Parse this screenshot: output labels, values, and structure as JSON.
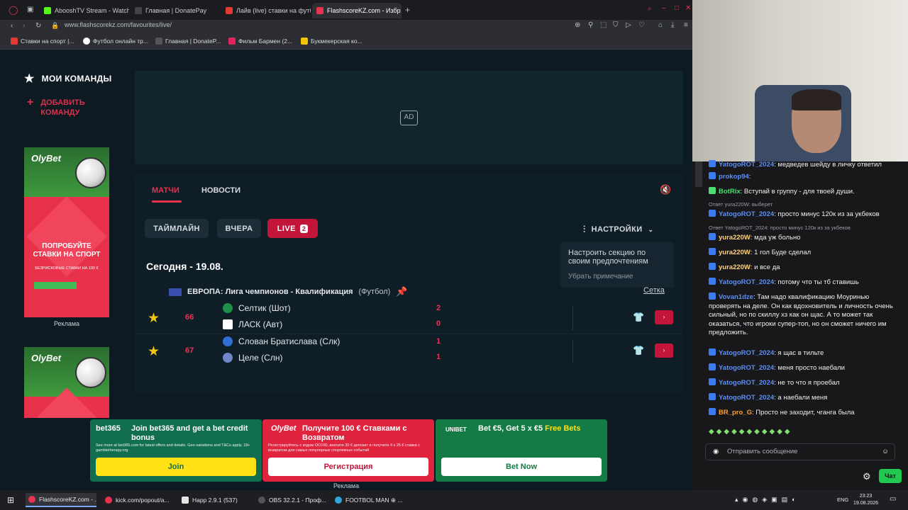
{
  "browser": {
    "tabs": [
      {
        "label": "AbooshTV Stream - Watch",
        "color": "#53fc18"
      },
      {
        "label": "Главная | DonatePay",
        "color": "#2b2b2b"
      },
      {
        "label": "Лайв (live) ставки на футб",
        "color": "#e53935"
      },
      {
        "label": "FlashscoreKZ.com - Избр",
        "color": "#e8334f"
      }
    ],
    "url": "www.flashscorekz.com/favourites/live/",
    "bookmarks": [
      {
        "label": "Ставки на спорт |...",
        "color": "#e53935"
      },
      {
        "label": "Футбол онлайн тр...",
        "color": "#ffffff"
      },
      {
        "label": "Главная | DonateP...",
        "color": "#2b2b2b"
      },
      {
        "label": "Фильм Бармен (2...",
        "color": "#e0245e"
      },
      {
        "label": "Букмекерская ко...",
        "color": "#f5c400"
      }
    ]
  },
  "sidebar": {
    "title": "МОИ КОМАНДЫ",
    "add_team": "ДОБАВИТЬ КОМАНДУ",
    "ad_label": "Реклама",
    "olybet_logo": "OlyBet",
    "olybet_promo": "ПОПРОБУЙТЕ СТАВКИ НА СПОРТ",
    "olybet_sub": "БЕЗРИСКОВЫЕ СТАВКИ НА 100 €"
  },
  "adbox": {
    "label": "AD"
  },
  "main": {
    "tabs": [
      {
        "label": "МАТЧИ"
      },
      {
        "label": "НОВОСТИ"
      }
    ],
    "filters": [
      {
        "label": "ТАЙМЛАЙН"
      },
      {
        "label": "ВЧЕРА"
      },
      {
        "label": "LIVE",
        "count": "2"
      }
    ],
    "settings_label": "НАСТРОЙКИ",
    "tooltip": {
      "text": "Настроить секцию по своим предпочтениям",
      "dismiss": "Убрать примечание"
    },
    "date_heading": "Сегодня - 19.08.",
    "league": {
      "name": "ЕВРОПА: Лига чемпионов - Квалификация",
      "category": "(Футбол)",
      "grid_link": "Сетка"
    },
    "matches": [
      {
        "minute": "66",
        "home": "Селтик (Шот)",
        "away": "ЛАСК (Авт)",
        "home_score": "2",
        "away_score": "0",
        "home_color": "#1f8f4a",
        "away_color": "#ffffff"
      },
      {
        "minute": "67",
        "home": "Слован Братислава (Слк)",
        "away": "Целе (Слн)",
        "home_score": "1",
        "away_score": "1",
        "home_color": "#2f6fd6",
        "away_color": "#6f87c8"
      }
    ]
  },
  "bottom_ads": {
    "label": "Реклама",
    "bet365": {
      "logo": "bet365",
      "title": "Join bet365 and get a bet credit bonus",
      "fine": "See more at bet365.com for latest offers and details. Geo-variations and T&Cs apply. 18+ gambletherapy.org",
      "cta": "Join"
    },
    "olybet": {
      "logo": "OlyBet",
      "title": "Получите 100 € Ставками с Возвратом",
      "fine": "Регистрируйтесь с кодом OO100, внесите 30 € депозит и получите 4 x 25 € ставки с возвратом для самых популярных спортивных событий",
      "cta": "Регистрация"
    },
    "unibet": {
      "logo": "UNIBET",
      "title": "Bet €5, Get 5 x €5",
      "title_accent": "Free Bets",
      "cta": "Bet Now"
    }
  },
  "chat": {
    "messages": [
      {
        "user": "YatogoROT_2024",
        "text": ": медведев шейду в личку ответил",
        "color": "blue"
      },
      {
        "user": "prokop94",
        "text": ":",
        "color": "blue"
      },
      {
        "user": "BotRix",
        "text": ": Вступай в группу - для твоей души.",
        "color": "green"
      },
      {
        "reply": "Ответ yura220W: выберет"
      },
      {
        "user": "YatogoROT_2024",
        "text": ": просто минус 120к из за укбеков",
        "color": "blue"
      },
      {
        "reply": "Ответ YatogoROT_2024: просто минус 120к из за укбеков"
      },
      {
        "user": "yura220W",
        "text": ": мда уж больно",
        "color": "yellow"
      },
      {
        "user": "yura220W",
        "text": ": 1 гол Буде сделал",
        "color": "yellow"
      },
      {
        "user": "yura220W",
        "text": ": и все да",
        "color": "yellow"
      },
      {
        "user": "YatogoROT_2024",
        "text": ": потому что ты тб ставишь",
        "color": "blue"
      },
      {
        "user": "Vovan1dze",
        "text": ": Там надо квалификацию Моуринью проверять на деле. Он как вдохновитель и личность очень сильный, но по скиллу хз как он щас. А то может так оказаться, что игроки супер-топ, но он сможет ничего им предложить.",
        "color": "blue"
      },
      {
        "user": "YatogoROT_2024",
        "text": ": я щас в тильте",
        "color": "blue"
      },
      {
        "user": "YatogoROT_2024",
        "text": ": меня просто наебали",
        "color": "blue"
      },
      {
        "user": "YatogoROT_2024",
        "text": ": не то что я проебал",
        "color": "blue"
      },
      {
        "user": "YatogoROT_2024",
        "text": ": а наебали меня",
        "color": "blue"
      },
      {
        "user": "BR_pro_G",
        "text": ": Просто не заходит, чганга была",
        "color": "orange"
      }
    ],
    "input_placeholder": "Отправить сообщение",
    "send_label": "Чат"
  },
  "taskbar": {
    "items": [
      {
        "label": "FlashscoreKZ.com - ..."
      },
      {
        "label": "kick.com/popout/a..."
      },
      {
        "label": "Happ 2.9.1 (537)"
      },
      {
        "label": "OBS 32.2.1 - Проф..."
      },
      {
        "label": "FOOTBOL MAN ⊕ ..."
      }
    ],
    "lang": "ENG",
    "time": "23:23",
    "date": "19.08.2026"
  }
}
